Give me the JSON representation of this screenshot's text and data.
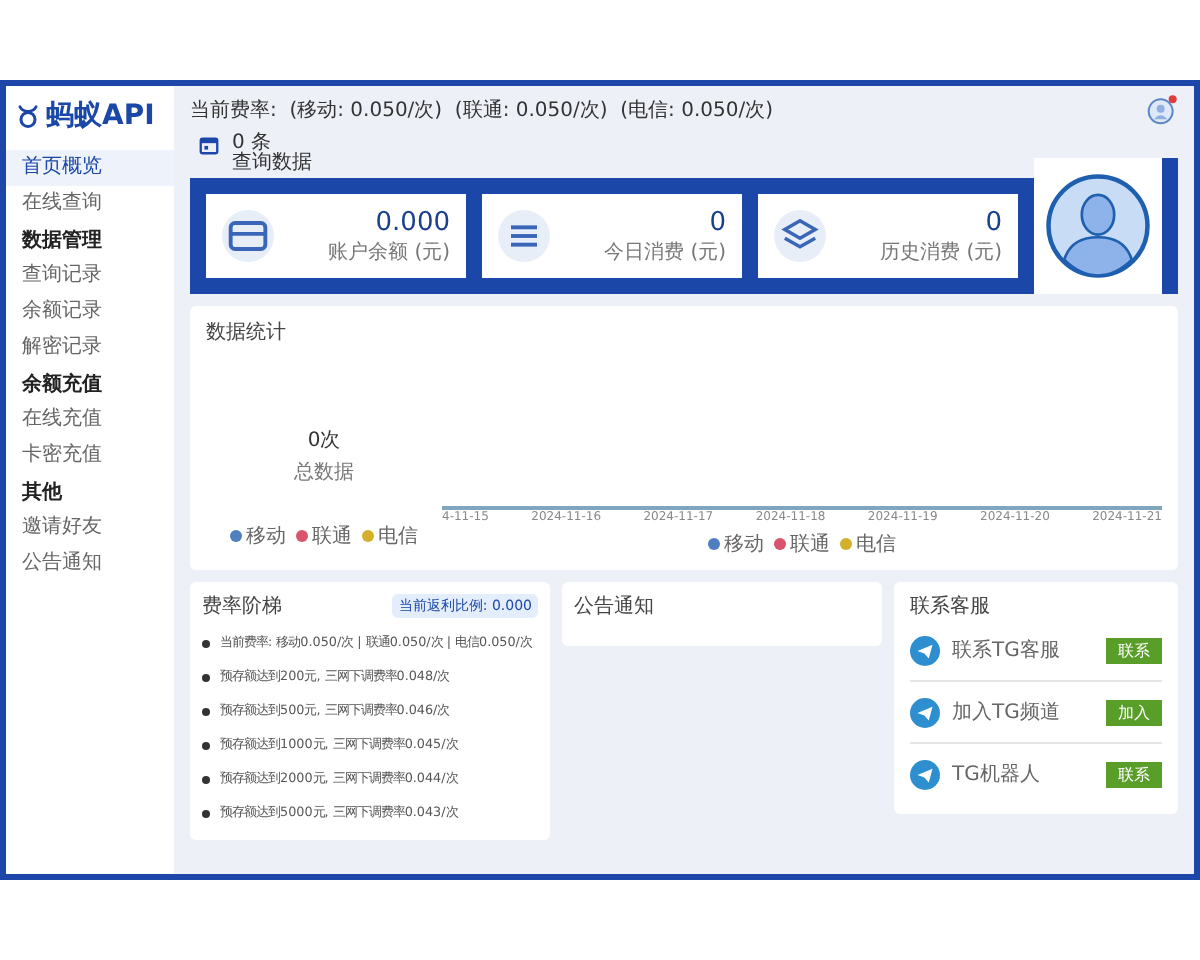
{
  "logo": {
    "text": "蚂蚁API"
  },
  "sidebar": {
    "items": [
      {
        "kind": "item",
        "label": "首页概览",
        "selected": true
      },
      {
        "kind": "item",
        "label": "在线查询",
        "selected": false
      },
      {
        "kind": "header",
        "label": "数据管理"
      },
      {
        "kind": "item",
        "label": "查询记录",
        "selected": false
      },
      {
        "kind": "item",
        "label": "余额记录",
        "selected": false
      },
      {
        "kind": "item",
        "label": "解密记录",
        "selected": false
      },
      {
        "kind": "header",
        "label": "余额充值"
      },
      {
        "kind": "item",
        "label": "在线充值",
        "selected": false
      },
      {
        "kind": "item",
        "label": "卡密充值",
        "selected": false
      },
      {
        "kind": "header",
        "label": "其他"
      },
      {
        "kind": "item",
        "label": "邀请好友",
        "selected": false
      },
      {
        "kind": "item",
        "label": "公告通知",
        "selected": false
      }
    ]
  },
  "topbar": {
    "rates": "当前费率:  (移动: 0.050/次)  (联通: 0.050/次)  (电信: 0.050/次)"
  },
  "today": {
    "count": "0 条",
    "label": "查询数据"
  },
  "stats": [
    {
      "kind": "wallet",
      "value": "0.000",
      "label": "账户余额 (元)"
    },
    {
      "kind": "list",
      "value": "0",
      "label": "今日消费 (元)"
    },
    {
      "kind": "layers",
      "value": "0",
      "label": "历史消费 (元)"
    }
  ],
  "chart_panel": {
    "title": "数据统计",
    "total": "0次",
    "total_label": "总数据",
    "legend": [
      {
        "label": "移动",
        "color": "#4f7fc0"
      },
      {
        "label": "联通",
        "color": "#d9536a"
      },
      {
        "label": "电信",
        "color": "#d4b02a"
      }
    ],
    "x_labels": [
      "4-11-15",
      "2024-11-16",
      "2024-11-17",
      "2024-11-18",
      "2024-11-19",
      "2024-11-20",
      "2024-11-21"
    ],
    "legend_bottom": [
      {
        "label": "移动",
        "color": "#4f7fc0"
      },
      {
        "label": "联通",
        "color": "#d9536a"
      },
      {
        "label": "电信",
        "color": "#d4b02a"
      }
    ]
  },
  "fees": {
    "title": "费率阶梯",
    "badge": "当前返利比例: 0.000",
    "items": [
      "当前费率: 移动0.050/次 | 联通0.050/次 | 电信0.050/次",
      "预存额达到200元, 三网下调费率0.048/次",
      "预存额达到500元, 三网下调费率0.046/次",
      "预存额达到1000元, 三网下调费率0.045/次",
      "预存额达到2000元, 三网下调费率0.044/次",
      "预存额达到5000元, 三网下调费率0.043/次"
    ]
  },
  "notice": {
    "title": "公告通知"
  },
  "contact": {
    "title": "联系客服",
    "items": [
      {
        "label": "联系TG客服",
        "button": "联系"
      },
      {
        "label": "加入TG频道",
        "button": "加入"
      },
      {
        "label": "TG机器人",
        "button": "联系"
      }
    ]
  }
}
